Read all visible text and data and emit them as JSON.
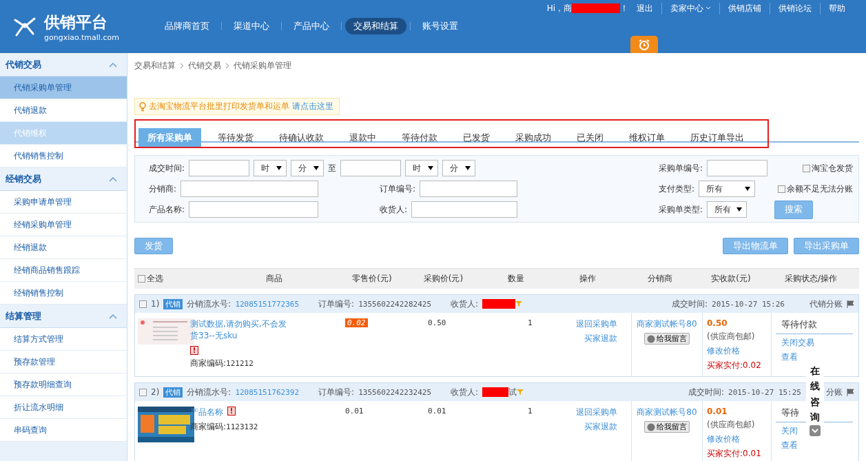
{
  "header": {
    "logo_title": "供销平台",
    "logo_domain": "gongxiao.tmall.com",
    "greeting": "Hi，商",
    "greeting_end": "！",
    "top_links": [
      {
        "label": "退出",
        "kind": "link"
      },
      {
        "label": "卖家中心",
        "kind": "dropdown"
      },
      {
        "label": "供销店铺",
        "kind": "link"
      },
      {
        "label": "供销论坛",
        "kind": "link"
      },
      {
        "label": "帮助",
        "kind": "link"
      }
    ],
    "nav": [
      {
        "label": "品牌商首页",
        "selected": false
      },
      {
        "label": "渠道中心",
        "selected": false
      },
      {
        "label": "产品中心",
        "selected": false
      },
      {
        "label": "交易和结算",
        "selected": true
      },
      {
        "label": "账号设置",
        "selected": false
      }
    ]
  },
  "sidebar": [
    {
      "title": "代销交易",
      "expanded": true,
      "items": [
        {
          "label": "代销采购单管理",
          "selected": true,
          "hovered": false
        },
        {
          "label": "代销退款",
          "selected": false,
          "hovered": false
        },
        {
          "label": "代销维权",
          "selected": false,
          "hovered": true
        },
        {
          "label": "代销销售控制",
          "selected": false,
          "hovered": false
        }
      ]
    },
    {
      "title": "经销交易",
      "expanded": true,
      "items": [
        {
          "label": "采购申请单管理",
          "selected": false,
          "hovered": false
        },
        {
          "label": "经销采购单管理",
          "selected": false,
          "hovered": false
        },
        {
          "label": "经销退款",
          "selected": false,
          "hovered": false
        },
        {
          "label": "经销商品销售跟踪",
          "selected": false,
          "hovered": false
        },
        {
          "label": "经销销售控制",
          "selected": false,
          "hovered": false
        }
      ]
    },
    {
      "title": "结算管理",
      "expanded": true,
      "items": [
        {
          "label": "结算方式管理",
          "selected": false,
          "hovered": false
        },
        {
          "label": "预存款管理",
          "selected": false,
          "hovered": false
        },
        {
          "label": "预存款明细查询",
          "selected": false,
          "hovered": false
        },
        {
          "label": "折让流水明细",
          "selected": false,
          "hovered": false
        },
        {
          "label": "串码查询",
          "selected": false,
          "hovered": false
        }
      ]
    }
  ],
  "breadcrumb": [
    "交易和结算",
    "代销交易",
    "代销采购单管理"
  ],
  "notice": {
    "text": "去淘宝物流平台批里打印发货单和运单",
    "link": "请点击这里"
  },
  "tabs": [
    {
      "label": "所有采购单",
      "selected": true
    },
    {
      "label": "等待发货",
      "selected": false
    },
    {
      "label": "待确认收款",
      "selected": false
    },
    {
      "label": "退款中",
      "selected": false
    },
    {
      "label": "等待付款",
      "selected": false
    },
    {
      "label": "已发货",
      "selected": false
    },
    {
      "label": "采购成功",
      "selected": false
    },
    {
      "label": "已关闭",
      "selected": false
    },
    {
      "label": "维权订单",
      "selected": false
    },
    {
      "label": "历史订单导出",
      "selected": false
    }
  ],
  "filters": {
    "deal_time_label": "成交时间:",
    "hours": [
      "时",
      "时"
    ],
    "minutes": [
      "分",
      "分"
    ],
    "to": "至",
    "distributor_label": "分销商:",
    "product_label": "产品名称:",
    "order_no_label": "订单编号:",
    "receiver_label": "收货人:",
    "po_no_label": "采购单编号:",
    "pay_type_label": "支付类型:",
    "pay_type_value": "所有",
    "po_type_label": "采购单类型:",
    "po_type_value": "所有",
    "checks": [
      {
        "label": "淘宝仓发货",
        "checked": false
      },
      {
        "label": "余额不足无法分账",
        "checked": false
      }
    ],
    "search_button": "搜索"
  },
  "ship_button": "发货",
  "export_buttons": [
    "导出物流单",
    "导出采购单"
  ],
  "table": {
    "select_all": "全选",
    "select_all_checked": false,
    "columns": [
      "商品",
      "零售价(元)",
      "采购价(元)",
      "数量",
      "操作",
      "分销商",
      "实收款(元)",
      "采购状态/操作"
    ],
    "orders": [
      {
        "index": "1)",
        "checked": false,
        "badge": "代销",
        "serial_label": "分销流水号:",
        "serial": "12085151772365",
        "order_label": "订单编号:",
        "order_no": "1355602242282425",
        "receiver_label": "收货人:",
        "time_label": "成交时间:",
        "time": "2015-10-27 15:26",
        "split": "代销分账",
        "kind": "document",
        "product": "测试数据,请勿购买,不会发货33--无sku",
        "warning": "!",
        "code_label": "商家编码:",
        "code": "121212",
        "retail": "0.02",
        "retail_highlight": true,
        "purchase": "0.50",
        "qty": "1",
        "actions": [
          "退回采购单",
          "买家退款"
        ],
        "seller": "商家测试帐号80",
        "message": "给我留言",
        "amount": "0.50",
        "shipping": "(供应商包邮)",
        "edit_price": "修改价格",
        "paid": "买家实付:0.02",
        "status": "等待付款",
        "status_links": [
          "关闭交易",
          "查看"
        ]
      },
      {
        "index": "2)",
        "checked": false,
        "badge": "代销",
        "serial_label": "分销流水号:",
        "serial": "12085151762392",
        "order_label": "订单编号:",
        "order_no": "1355602242232425",
        "receiver_label": "收货人:",
        "receiver_tail": "试",
        "time_label": "成交时间:",
        "time": "2015-10-27 15:25",
        "split": "分账",
        "kind": "picture",
        "product": "产品名称",
        "warning": "!",
        "code_label": "商家编码:",
        "code": "1123132",
        "retail": "0.01",
        "retail_highlight": false,
        "purchase": "0.01",
        "qty": "1",
        "actions": [
          "退回采购单",
          "买家退款"
        ],
        "seller": "商家测试帐号80",
        "message": "给我留言",
        "amount": "0.01",
        "shipping": "(供应商包邮)",
        "edit_price": "修改价格",
        "paid": "买家实付:0.01",
        "status": "等待",
        "status_links": [
          "关闭",
          "查看"
        ]
      }
    ]
  },
  "consult_widget": {
    "chars": "在线咨询"
  }
}
